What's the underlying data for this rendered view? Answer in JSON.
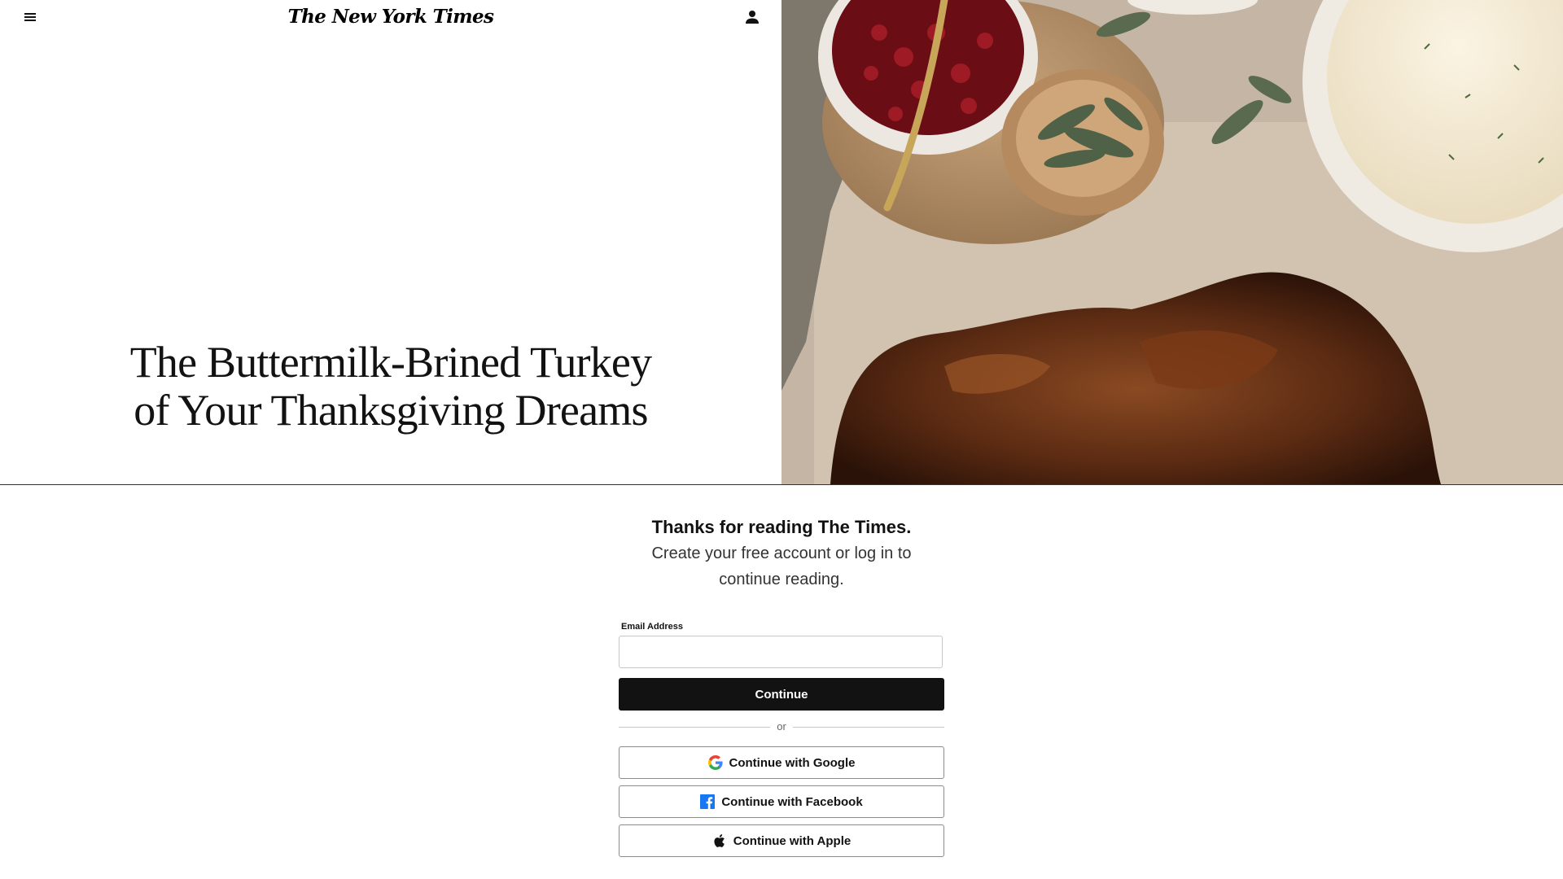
{
  "masthead": {
    "logo_text": "The New York Times",
    "menu_icon": "hamburger-menu-icon",
    "account_icon": "user-account-icon"
  },
  "article": {
    "headline": "The Buttermilk-Brined Turkey of Your Thanksgiving Dreams",
    "hero_image": "thanksgiving-spread-photo"
  },
  "regiwall": {
    "title": "Thanks for reading The Times.",
    "subtitle": "Create your free account or log in to continue reading.",
    "email_label": "Email Address",
    "email_value": "",
    "email_placeholder": "",
    "continue_label": "Continue",
    "divider_text": "or",
    "google_label": "Continue with Google",
    "facebook_label": "Continue with Facebook",
    "apple_label": "Continue with Apple"
  },
  "colors": {
    "text": "#121212",
    "button_dark": "#121212",
    "facebook_blue": "#1877F2",
    "border": "#c7c7c7"
  }
}
